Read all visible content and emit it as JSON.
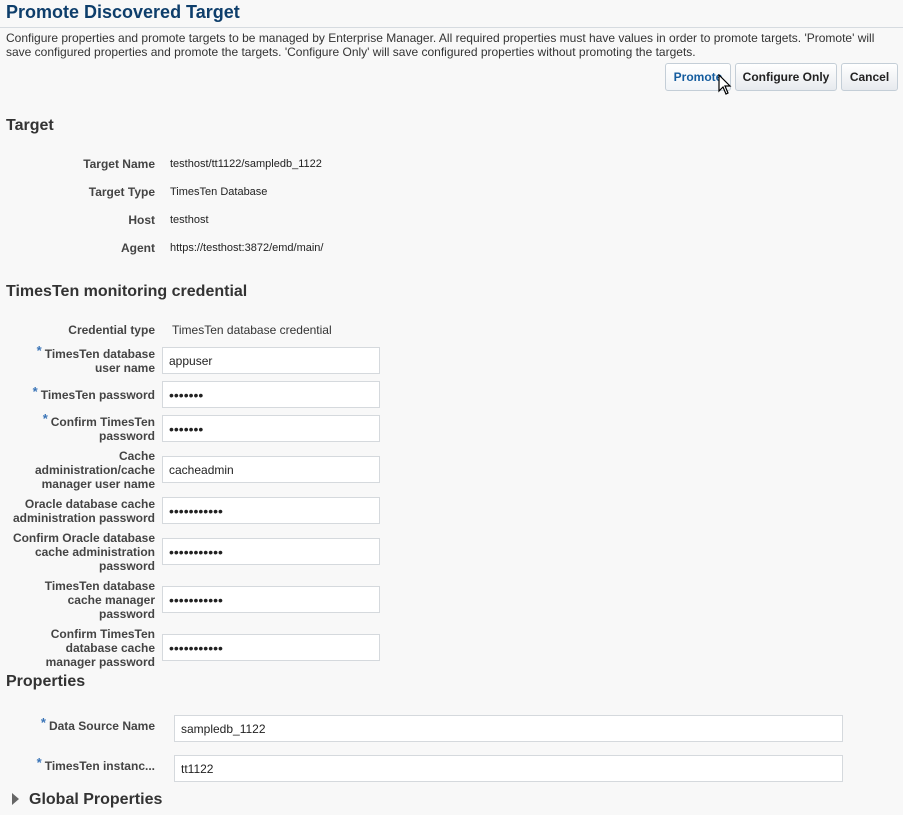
{
  "page": {
    "title": "Promote Discovered Target",
    "description": "Configure properties and promote targets to be managed by Enterprise Manager. All required properties must have values in order to promote targets. 'Promote' will save configured properties and promote the targets. 'Configure Only' will save configured properties without promoting the targets."
  },
  "buttons": {
    "promote": "Promote",
    "configure_only": "Configure Only",
    "cancel": "Cancel"
  },
  "target_section": {
    "heading": "Target",
    "rows": [
      {
        "label": "Target Name",
        "value": "testhost/tt1122/sampledb_1122"
      },
      {
        "label": "Target Type",
        "value": "TimesTen Database"
      },
      {
        "label": "Host",
        "value": "testhost"
      },
      {
        "label": "Agent",
        "value": "https://testhost:3872/emd/main/"
      }
    ]
  },
  "credential_section": {
    "heading": "TimesTen monitoring credential",
    "credential_type_label": "Credential type",
    "credential_type_value": "TimesTen database credential",
    "fields": [
      {
        "label_lines": [
          "TimesTen database",
          "user name"
        ],
        "required": true,
        "value": "appuser"
      },
      {
        "label_lines": [
          "TimesTen password"
        ],
        "required": true,
        "value": "•••••••"
      },
      {
        "label_lines": [
          "Confirm TimesTen",
          "password"
        ],
        "required": true,
        "value": "•••••••"
      },
      {
        "label_lines": [
          "Cache",
          "administration/cache",
          "manager user name"
        ],
        "required": false,
        "value": "cacheadmin"
      },
      {
        "label_lines": [
          "Oracle database cache",
          "administration password"
        ],
        "required": false,
        "value": "•••••••••••"
      },
      {
        "label_lines": [
          "Confirm Oracle database",
          "cache administration",
          "password"
        ],
        "required": false,
        "value": "•••••••••••"
      },
      {
        "label_lines": [
          "TimesTen database",
          "cache manager",
          "password"
        ],
        "required": false,
        "value": "•••••••••••"
      },
      {
        "label_lines": [
          "Confirm TimesTen",
          "database cache",
          "manager password"
        ],
        "required": false,
        "value": "•••••••••••"
      }
    ]
  },
  "properties_section": {
    "heading": "Properties",
    "fields": [
      {
        "label": "Data Source Name",
        "required": true,
        "value": "sampledb_1122"
      },
      {
        "label": "TimesTen instanc...",
        "required": true,
        "value": "tt1122"
      }
    ]
  },
  "global_properties": {
    "heading": "Global Properties",
    "expanded": false
  },
  "colors": {
    "title": "#0e3e6b",
    "required_marker": "#3a74b7",
    "primary_button_text": "#145c9e",
    "background": "#f8f8f8"
  }
}
